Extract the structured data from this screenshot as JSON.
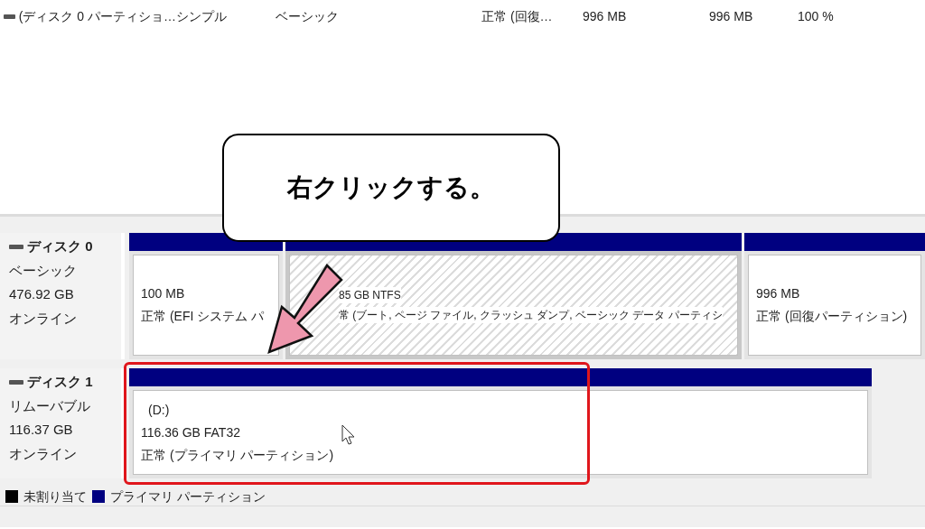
{
  "volume_list": {
    "rows": [
      {
        "cells": [
          "(ディスク 0 パーティショ…",
          "シンプル",
          "ベーシック",
          "正常 (回復…",
          "996 MB",
          "996 MB",
          "100 %"
        ]
      }
    ]
  },
  "disks": [
    {
      "name": "ディスク 0",
      "type": "ベーシック",
      "size": "476.92 GB",
      "status": "オンライン",
      "partitions": [
        {
          "lines": [
            "100 MB",
            "正常 (EFI システム パ"
          ],
          "selected": false
        },
        {
          "lines": [
            "85 GB NTFS",
            "常 (ブート, ページ ファイル, クラッシュ ダンプ, ベーシック データ パーティシ"
          ],
          "selected": true
        },
        {
          "lines": [
            "996 MB",
            "正常 (回復パーティション)"
          ],
          "selected": false
        }
      ]
    },
    {
      "name": "ディスク 1",
      "type": "リムーバブル",
      "size": "116.37 GB",
      "status": "オンライン",
      "partitions": [
        {
          "lines": [
            "(D:)",
            "116.36 GB FAT32",
            "正常 (プライマリ パーティション)"
          ],
          "selected": false
        }
      ]
    }
  ],
  "legend": [
    {
      "label": "未割り当て",
      "color": "#000000"
    },
    {
      "label": "プライマリ パーティション",
      "color": "#000080"
    }
  ],
  "callout": {
    "text": "右クリックする。"
  }
}
